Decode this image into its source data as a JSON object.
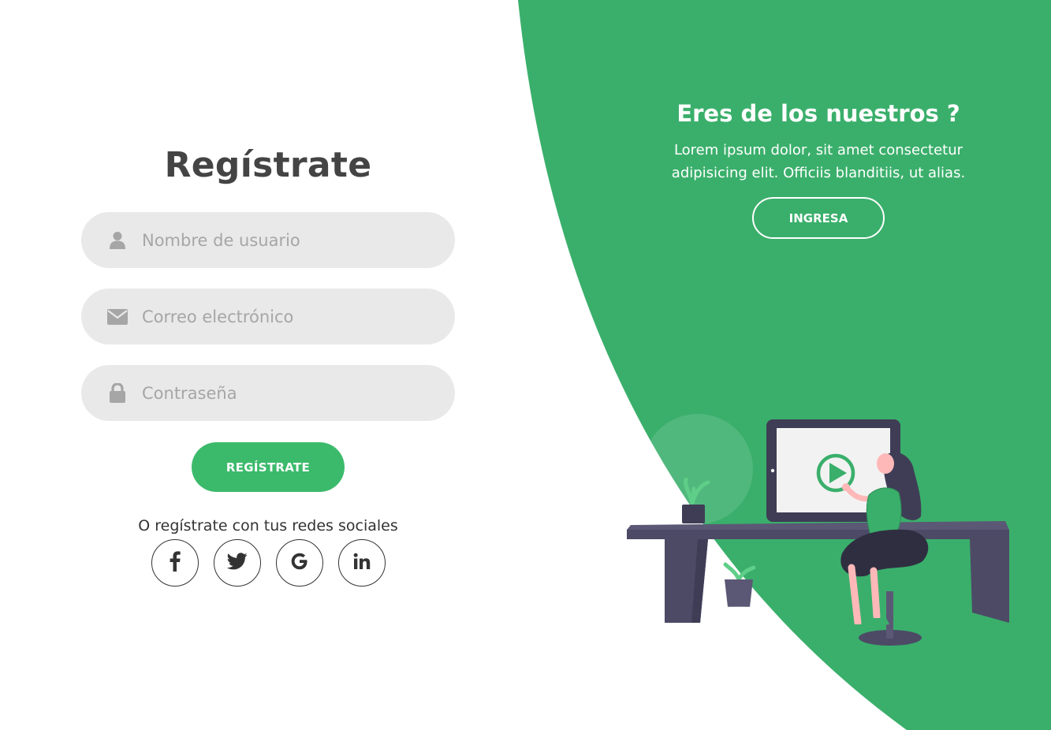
{
  "form": {
    "title": "Regístrate",
    "username_placeholder": "Nombre de usuario",
    "email_placeholder": "Correo electrónico",
    "password_placeholder": "Contraseña",
    "submit_label": "REGÍSTRATE",
    "social_text": "O regístrate con tus redes sociales",
    "social": [
      {
        "name": "facebook",
        "glyph": "f"
      },
      {
        "name": "twitter",
        "glyph": "bird"
      },
      {
        "name": "google",
        "glyph": "G"
      },
      {
        "name": "linkedin",
        "glyph": "in"
      }
    ]
  },
  "promo": {
    "title": "Eres de los nuestros ?",
    "text": "Lorem ipsum dolor, sit amet consectetur adipisicing elit. Officiis blanditiis, ut alias.",
    "button_label": "INGRESA"
  },
  "icons": {
    "user": "user-icon",
    "email": "envelope-icon",
    "password": "lock-icon"
  },
  "colors": {
    "accent_green": "#3cba6c",
    "panel_green": "#3aaf6b",
    "field_bg": "#e9e9e9",
    "title_text": "#444444"
  }
}
